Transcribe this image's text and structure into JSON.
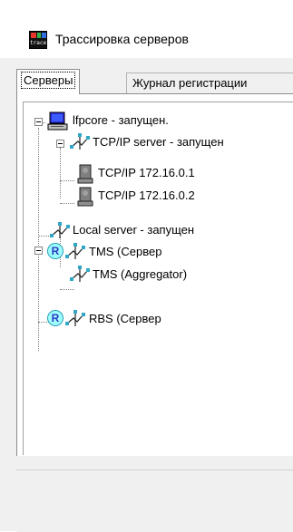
{
  "window": {
    "title": "Трассировка серверов",
    "icon_label": "trace"
  },
  "tabs": [
    {
      "label": "Серверы",
      "active": true
    },
    {
      "label": "Журнал регистрации",
      "active": false
    }
  ],
  "tree": {
    "items": [
      {
        "label": "lfpcore   - запущен.",
        "icon": "computer-icon"
      },
      {
        "label": "TCP/IP server   - запущен",
        "icon": "network-icon"
      },
      {
        "label": "TCP/IP 172.16.0.1",
        "icon": "client-icon"
      },
      {
        "label": "TCP/IP 172.16.0.2",
        "icon": "client-icon"
      },
      {
        "label": "Local server   - запущен",
        "icon": "network-icon"
      },
      {
        "label": "TMS (Сервер",
        "icon": "network-icon",
        "badge": "R"
      },
      {
        "label": "TMS (Aggregator)",
        "icon": "network-icon"
      },
      {
        "label": "RBS (Сервер",
        "icon": "network-icon",
        "badge": "R"
      }
    ]
  }
}
